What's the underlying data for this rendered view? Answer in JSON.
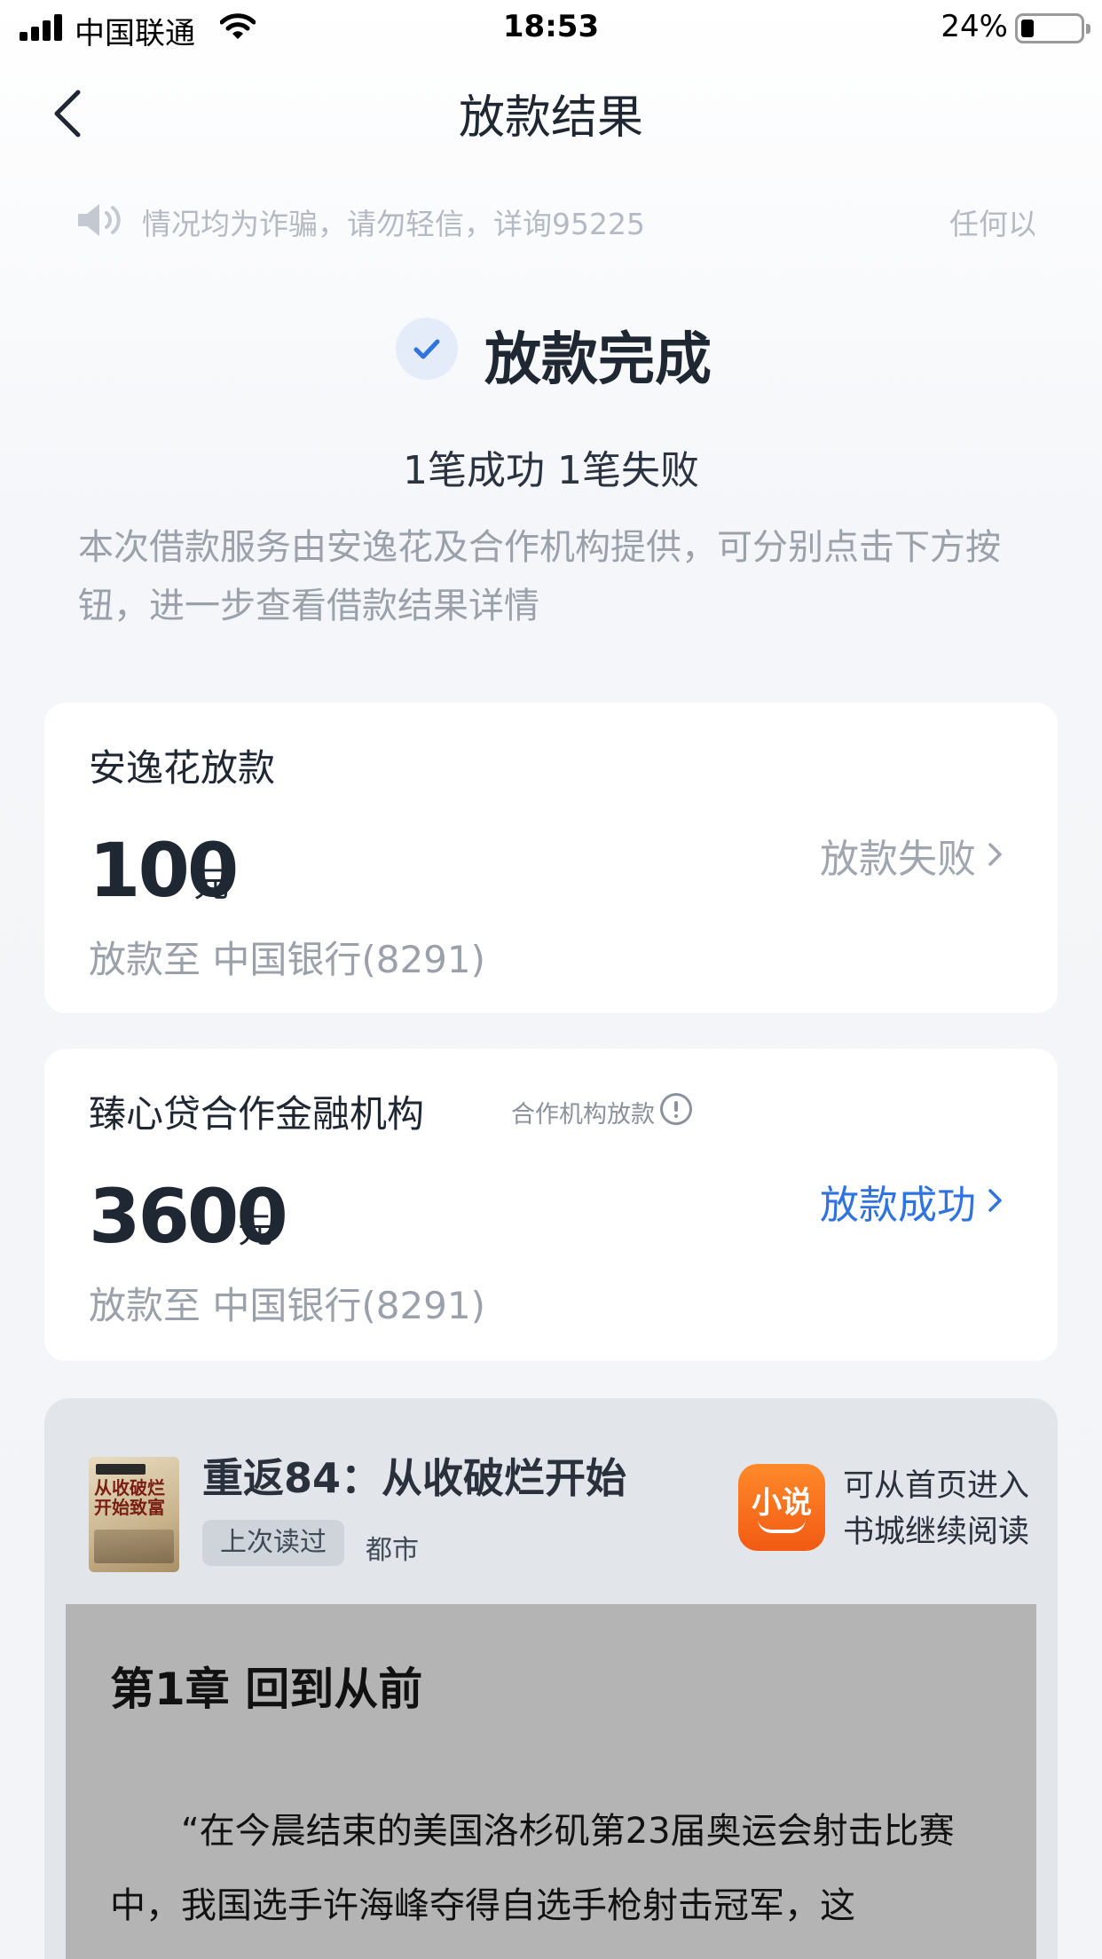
{
  "status_bar": {
    "carrier": "中国联通",
    "time": "18:53",
    "battery_percent": "24%",
    "battery_level": 0.24
  },
  "nav": {
    "title": "放款结果"
  },
  "notice": {
    "text": "情况均为诈骗，请勿轻信，详询95225",
    "text_trailing": "任何以"
  },
  "result": {
    "title": "放款完成",
    "summary": "1笔成功 1笔失败",
    "description": "本次借款服务由安逸花及合作机构提供，可分别点击下方按钮，进一步查看借款结果详情"
  },
  "loans": [
    {
      "title": "安逸花放款",
      "amount": "100",
      "unit": "元",
      "status": "放款失败",
      "destination": "放款至 中国银行(8291)"
    },
    {
      "title": "臻心贷合作金融机构",
      "tag": "合作机构放款",
      "amount": "3600",
      "unit": "元",
      "status": "放款成功",
      "destination": "放款至 中国银行(8291)"
    }
  ],
  "book": {
    "cover_text": "从收破烂开始致富",
    "title": "重返84：从收破烂开始",
    "badge": "上次读过",
    "genre": "都市",
    "app_icon_label": "小说",
    "hint_line1": "可从首页进入",
    "hint_line2": "书城继续阅读",
    "chapter": "第1章  回到从前",
    "paragraph": "“在今晨结束的美国洛杉矶第23届奥运会射击比赛中，我国选手许海峰夺得自选手枪射击冠军，这"
  },
  "colors": {
    "accent_blue": "#2f73e0",
    "fail_gray": "#a0a6af",
    "app_orange": "#f25a13"
  }
}
